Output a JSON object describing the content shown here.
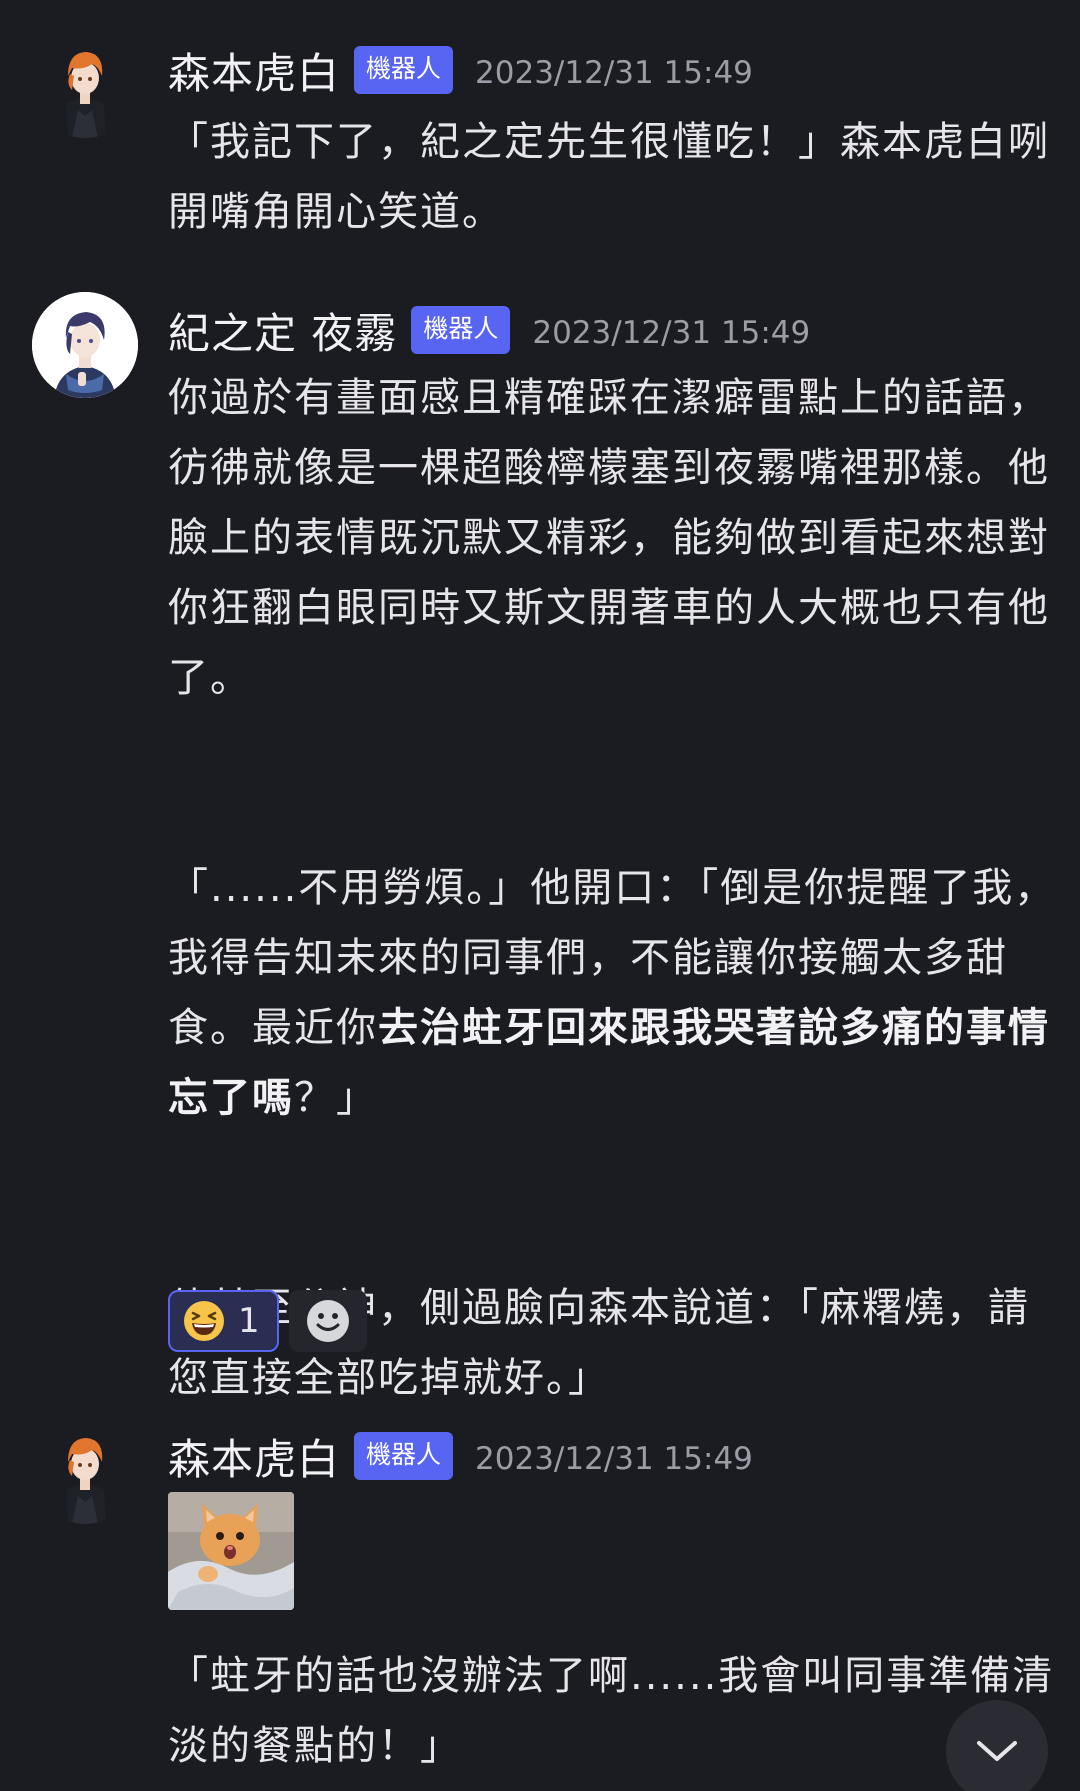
{
  "messages": [
    {
      "username": "森本虎白",
      "badge": "機器人",
      "timestamp": "2023/12/31 15:49",
      "text": "「我記下了，紀之定先生很懂吃！」森本虎白咧開嘴角開心笑道。"
    },
    {
      "username": "紀之定 夜霧",
      "badge": "機器人",
      "timestamp": "2023/12/31 15:49",
      "p1": "你過於有畫面感且精確踩在潔癖雷點上的話語，彷彿就像是一棵超酸檸檬塞到夜霧嘴裡那樣。他臉上的表情既沉默又精彩，能夠做到看起來想對你狂翻白眼同時又斯文開著車的人大概也只有他了。",
      "p2_plain": "「......不用勞煩。」他開口：「倒是你提醒了我，我得告知未來的同事們，不能讓你接觸太多甜食。最近你",
      "p2_bold": "去治蛀牙回來跟我哭著說多痛的事情忘了嗎",
      "p2_end": "？」",
      "p3": "他甚至分神，側過臉向森本說道：「麻糬燒，請您直接全部吃掉就好。」",
      "reactions": [
        {
          "emoji": "grinning-squinting-face",
          "count": "1"
        }
      ],
      "add_reaction_icon": "add-reaction-icon"
    },
    {
      "username": "森本虎白",
      "badge": "機器人",
      "timestamp": "2023/12/31 15:49",
      "image": "cat-sticker",
      "text": "「蛀牙的話也沒辦法了啊......我會叫同事準備清淡的餐點的！」"
    }
  ],
  "scroll_button_icon": "chevron-down-icon",
  "colors": {
    "background": "#1b1c22",
    "badge": "#5865f2",
    "reaction_active_bg": "#2a2e52",
    "text": "#e6e6ea",
    "timestamp": "#9b9ca6"
  }
}
